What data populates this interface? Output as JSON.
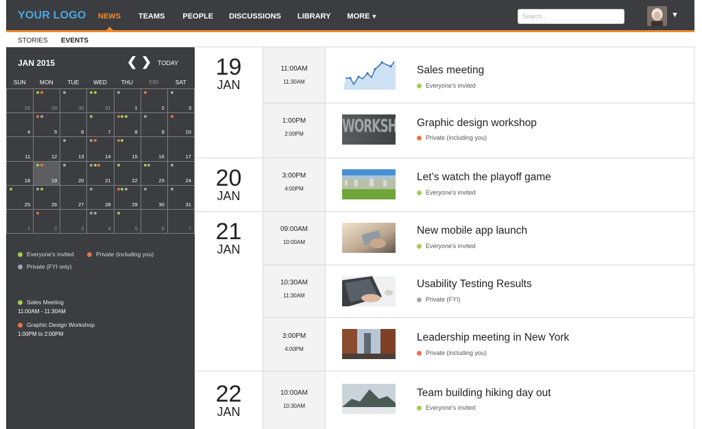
{
  "colors": {
    "green": "#a3cc52",
    "orange": "#e8734a",
    "gray": "#a6a6a6",
    "accent": "#f0892d",
    "logo": "#4da7e0"
  },
  "header": {
    "logo": "YOUR LOGO",
    "nav": [
      "NEWS",
      "TEAMS",
      "PEOPLE",
      "DISCUSSIONS",
      "LIBRARY",
      "MORE"
    ],
    "more_caret": "▼",
    "search_placeholder": "Search...",
    "user_caret": "▼"
  },
  "subnav": {
    "stories": "STORIES",
    "events": "EVENTS"
  },
  "calendar": {
    "month": "JAN 2015",
    "prev": "❮",
    "next": "❯",
    "today": "TODAY",
    "weekdays": [
      "SUN",
      "MON",
      "TUE",
      "WED",
      "THU",
      "FRI",
      "SAT"
    ],
    "cells": [
      {
        "d": "28",
        "m": true,
        "dots": []
      },
      {
        "d": "29",
        "m": true,
        "dots": [
          "green",
          "orange"
        ]
      },
      {
        "d": "30",
        "m": true,
        "dots": [
          "gray"
        ]
      },
      {
        "d": "31",
        "m": true,
        "dots": [
          "green",
          "green"
        ]
      },
      {
        "d": "1",
        "dots": [
          "gray"
        ]
      },
      {
        "d": "2",
        "dots": [
          "orange"
        ]
      },
      {
        "d": "3",
        "dots": [
          "gray"
        ]
      },
      {
        "d": "4",
        "dots": []
      },
      {
        "d": "5",
        "dots": [
          "orange",
          "gray"
        ]
      },
      {
        "d": "6",
        "dots": []
      },
      {
        "d": "7",
        "dots": [
          "green"
        ]
      },
      {
        "d": "8",
        "dots": [
          "orange",
          "green",
          "green"
        ]
      },
      {
        "d": "9",
        "dots": [
          "gray"
        ]
      },
      {
        "d": "10",
        "dots": [
          "orange"
        ]
      },
      {
        "d": "11",
        "dots": []
      },
      {
        "d": "12",
        "dots": []
      },
      {
        "d": "13",
        "dots": [
          "gray"
        ]
      },
      {
        "d": "14",
        "dots": [
          "gray",
          "orange"
        ]
      },
      {
        "d": "15",
        "dots": [
          "orange",
          "green"
        ]
      },
      {
        "d": "16",
        "dots": []
      },
      {
        "d": "17",
        "dots": []
      },
      {
        "d": "18",
        "dots": []
      },
      {
        "d": "19",
        "sel": true,
        "dots": [
          "green",
          "orange"
        ]
      },
      {
        "d": "20",
        "dots": [
          "gray"
        ]
      },
      {
        "d": "21",
        "dots": [
          "gray",
          "green",
          "orange"
        ]
      },
      {
        "d": "22",
        "dots": [
          "green"
        ]
      },
      {
        "d": "23",
        "dots": [
          "green",
          "gray"
        ]
      },
      {
        "d": "24",
        "dots": [
          "gray"
        ]
      },
      {
        "d": "25",
        "dots": [
          "green"
        ]
      },
      {
        "d": "26",
        "dots": [
          "gray",
          "green"
        ]
      },
      {
        "d": "27",
        "dots": []
      },
      {
        "d": "28",
        "dots": [
          "gray"
        ]
      },
      {
        "d": "29",
        "dots": [
          "orange",
          "green",
          "gray"
        ]
      },
      {
        "d": "30",
        "dots": [
          "gray"
        ]
      },
      {
        "d": "31",
        "dots": [
          "gray"
        ]
      },
      {
        "d": "1",
        "m": true,
        "dots": []
      },
      {
        "d": "2",
        "m": true,
        "dots": [
          "orange"
        ]
      },
      {
        "d": "3",
        "m": true,
        "dots": []
      },
      {
        "d": "4",
        "m": true,
        "dots": [
          "gray",
          "gray"
        ]
      },
      {
        "d": "5",
        "m": true,
        "dots": [
          "green"
        ]
      },
      {
        "d": "6",
        "m": true,
        "dots": []
      },
      {
        "d": "7",
        "m": true,
        "dots": []
      }
    ]
  },
  "legend": {
    "everyone": "Everyone's invited",
    "private_you": "Private (including you)",
    "private_fyi": "Private (FYI only)"
  },
  "upcoming": [
    {
      "title": "Sales Meeting",
      "time": "11:00AM - 11:30AM",
      "color": "green"
    },
    {
      "title": "Graphic Design Workshop",
      "time": "1:00PM to 2:00PM",
      "color": "orange"
    }
  ],
  "groups": [
    {
      "day": "19",
      "mon": "JAN",
      "events": [
        {
          "start": "11:00AM",
          "end": "11:30AM",
          "title": "Sales meeting",
          "access": "Everyone's invited",
          "color": "green",
          "thumb": "chart-thumbnail"
        },
        {
          "start": "1:00PM",
          "end": "2:00PM",
          "title": "Graphic design workshop",
          "access": "Private (including you)",
          "color": "orange",
          "thumb": "workshop-thumbnail",
          "thumb_text": "WORKSHOP"
        }
      ]
    },
    {
      "day": "20",
      "mon": "JAN",
      "events": [
        {
          "start": "3:00PM",
          "end": "4:00PM",
          "title": "Let’s watch the playoff game",
          "access": "Everyone's invited",
          "color": "green",
          "thumb": "stadium-thumbnail"
        }
      ]
    },
    {
      "day": "21",
      "mon": "JAN",
      "events": [
        {
          "start": "09:00AM",
          "end": "10:00AM",
          "title": "New mobile app launch",
          "access": "Everyone's invited",
          "color": "green",
          "thumb": "phone-thumbnail"
        },
        {
          "start": "10:30AM",
          "end": "11:30AM",
          "title": "Usability Testing Results",
          "access": "Private (FYI)",
          "color": "gray",
          "thumb": "laptop-thumbnail"
        },
        {
          "start": "3:00PM",
          "end": "4:00PM",
          "title": "Leadership meeting in New York",
          "access": "Private (including you)",
          "color": "orange",
          "thumb": "bridge-thumbnail"
        }
      ]
    },
    {
      "day": "22",
      "mon": "JAN",
      "events": [
        {
          "start": "10:00AM",
          "end": "10:30AM",
          "title": "Team building hiking day out",
          "access": "Everyone's invited",
          "color": "green",
          "thumb": "mountain-thumbnail"
        }
      ]
    }
  ]
}
